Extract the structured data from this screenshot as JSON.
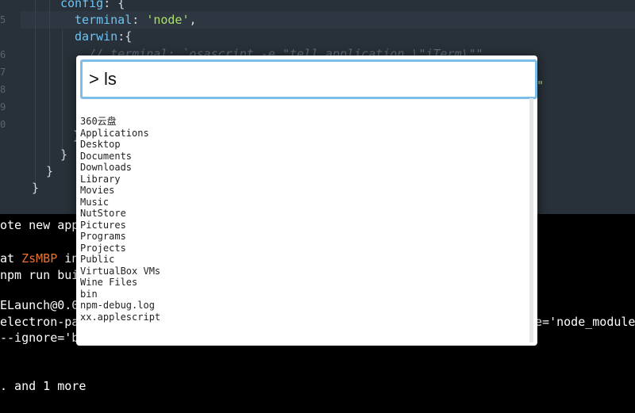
{
  "editor": {
    "line_numbers": [
      "5",
      "6",
      "7",
      "8",
      "9",
      "0"
    ],
    "lines": [
      {
        "parts": [
          {
            "t": "config",
            "c": "prop"
          },
          {
            "t": ": {",
            "c": "punc"
          }
        ]
      },
      {
        "parts": [
          {
            "t": "terminal",
            "c": "prop"
          },
          {
            "t": ": ",
            "c": "punc"
          },
          {
            "t": "'node'",
            "c": "str"
          },
          {
            "t": ",",
            "c": "punc"
          }
        ]
      },
      {
        "parts": [
          {
            "t": "darwin",
            "c": "prop"
          },
          {
            "t": ":{",
            "c": "punc"
          }
        ]
      },
      {
        "parts": [
          {
            "t": "// terminal: `osascript -e \"tell application \\\"iTerm\\\"\"",
            "c": "cmt"
          }
        ]
      },
      {
        "parts": [
          {
            "t": "\"",
            "c": "str"
          }
        ]
      },
      {
        "parts": [
          {
            "t": "}",
            "c": "punc"
          }
        ]
      },
      {
        "parts": [
          {
            "t": "}",
            "c": "punc"
          }
        ]
      },
      {
        "parts": [
          {
            "t": "}",
            "c": "punc"
          }
        ]
      },
      {
        "parts": [
          {
            "t": "}",
            "c": "punc"
          }
        ]
      }
    ]
  },
  "terminal": {
    "line1": "ote new app",
    "line2_prefix": "at ",
    "line2_host": "ZsMBP",
    "line2_suffix": " in",
    "line3": "npm run bui",
    "line4": "ELaunch@0.0",
    "line5_left": "electron-pa",
    "line5_right": "re='node_module",
    "line6": "--ignore='b",
    "line7": ". and 1 more"
  },
  "dialog": {
    "query": "> ls",
    "results": [
      "360云盘",
      "Applications",
      "Desktop",
      "Documents",
      "Downloads",
      "Library",
      "Movies",
      "Music",
      "NutStore",
      "Pictures",
      "Programs",
      "Projects",
      "Public",
      "VirtualBox VMs",
      "Wine Files",
      "bin",
      "npm-debug.log",
      "xx.applescript"
    ]
  }
}
